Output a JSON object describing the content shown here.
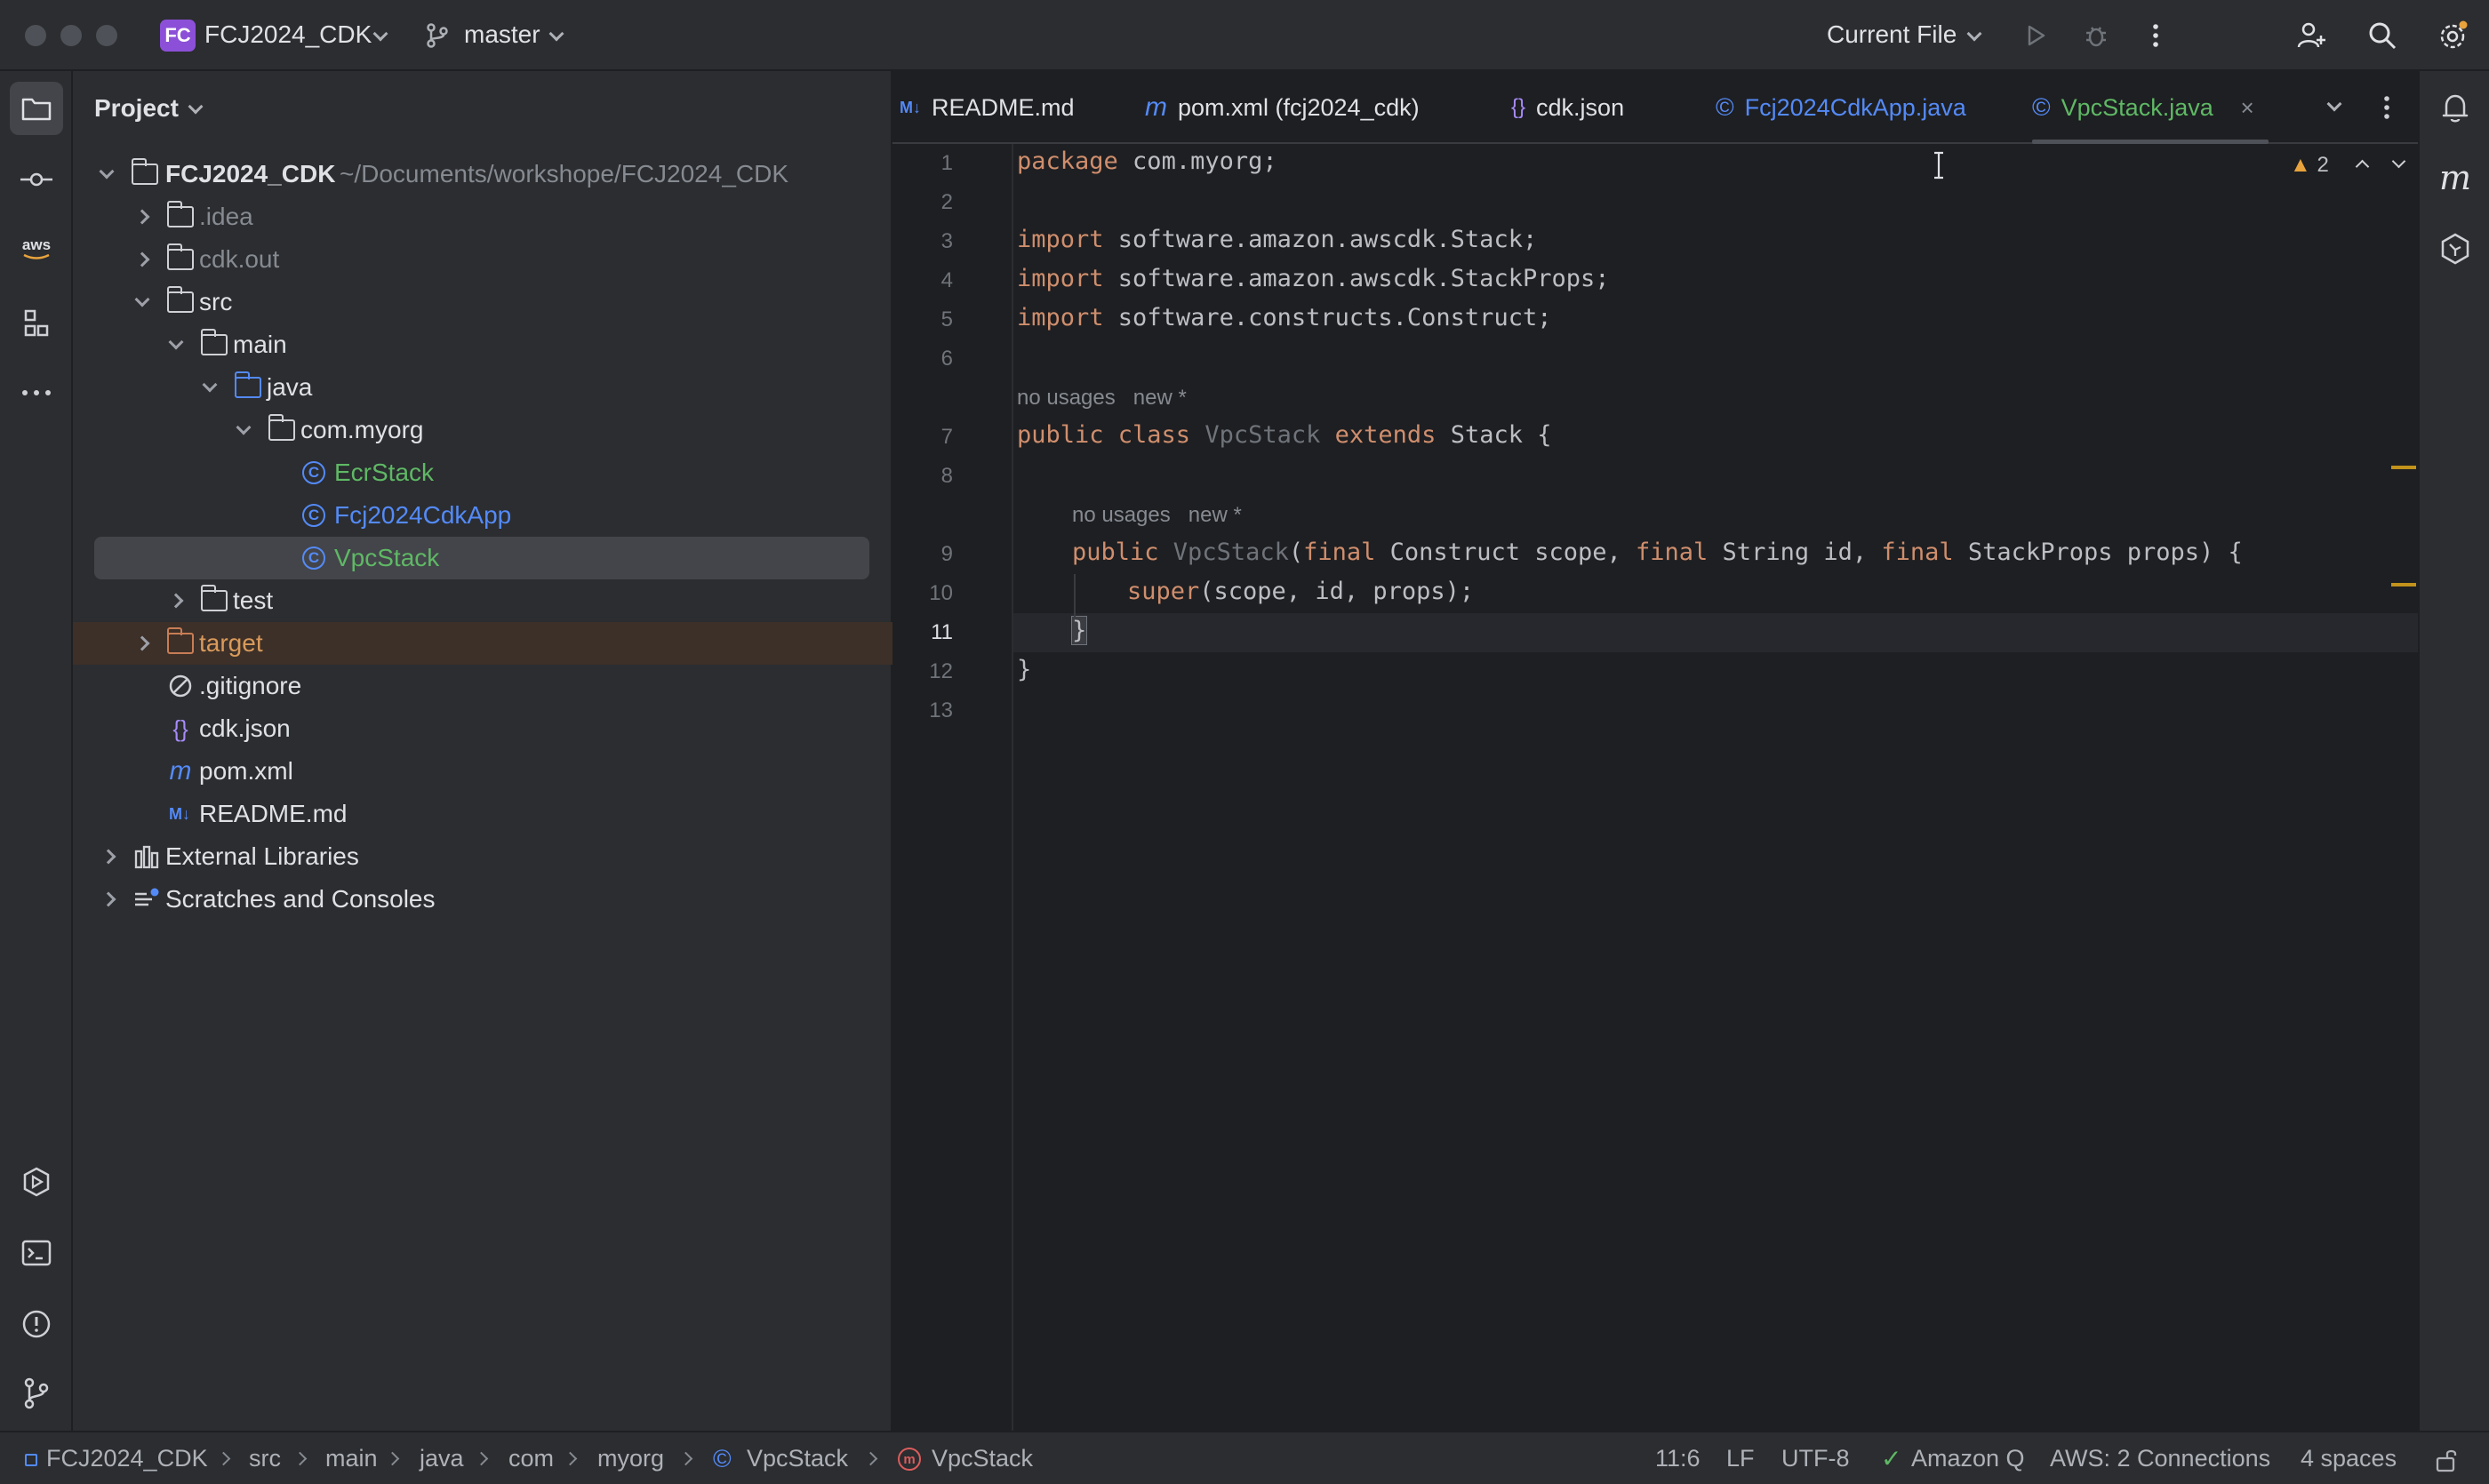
{
  "titlebar": {
    "project_badge": "FC",
    "project_name": "FCJ2024_CDK",
    "branch": "master",
    "run_config": "Current File"
  },
  "project_panel": {
    "title": "Project",
    "tree": [
      {
        "label": "FCJ2024_CDK",
        "path": "~/Documents/workshope/FCJ2024_CDK",
        "type": "root"
      },
      {
        "label": ".idea",
        "type": "folder"
      },
      {
        "label": "cdk.out",
        "type": "folder"
      },
      {
        "label": "src",
        "type": "folder"
      },
      {
        "label": "main",
        "type": "folder"
      },
      {
        "label": "java",
        "type": "source-folder"
      },
      {
        "label": "com.myorg",
        "type": "package"
      },
      {
        "label": "EcrStack",
        "type": "class"
      },
      {
        "label": "Fcj2024CdkApp",
        "type": "class"
      },
      {
        "label": "VpcStack",
        "type": "class"
      },
      {
        "label": "test",
        "type": "folder"
      },
      {
        "label": "target",
        "type": "excluded-folder"
      },
      {
        "label": ".gitignore",
        "type": "file"
      },
      {
        "label": "cdk.json",
        "type": "json"
      },
      {
        "label": "pom.xml",
        "type": "maven"
      },
      {
        "label": "README.md",
        "type": "markdown"
      },
      {
        "label": "External Libraries",
        "type": "libraries"
      },
      {
        "label": "Scratches and Consoles",
        "type": "scratches"
      }
    ]
  },
  "tabs": [
    {
      "label": "README.md",
      "icon": "M↓"
    },
    {
      "label": "pom.xml (fcj2024_cdk)",
      "icon": "m"
    },
    {
      "label": "cdk.json",
      "icon": "{}"
    },
    {
      "label": "Fcj2024CdkApp.java",
      "icon": "©"
    },
    {
      "label": "VpcStack.java",
      "icon": "©"
    }
  ],
  "editor": {
    "warning_count": "2",
    "line_numbers": [
      "1",
      "2",
      "3",
      "4",
      "5",
      "6",
      "7",
      "8",
      "9",
      "10",
      "11",
      "12",
      "13"
    ],
    "hints": {
      "class_usages": "no usages",
      "class_new": "new *",
      "ctor_usages": "no usages",
      "ctor_new": "new *"
    },
    "code": {
      "l1_kw": "package",
      "l1_rest": " com.myorg;",
      "l3_kw": "import",
      "l3_rest": " software.amazon.awscdk.Stack;",
      "l4_kw": "import",
      "l4_rest": " software.amazon.awscdk.StackProps;",
      "l5_kw": "import",
      "l5_rest": " software.constructs.Construct;",
      "l7_kw1": "public class",
      "l7_name": " VpcStack",
      "l7_kw2": " extends",
      "l7_rest": " Stack {",
      "l9_kw": "public",
      "l9_name": " VpcStack",
      "l9_p1": "(",
      "l9_f1": "final",
      "l9_t1": " Construct scope, ",
      "l9_f2": "final",
      "l9_t2": " String id, ",
      "l9_f3": "final",
      "l9_t3": " StackProps props) {",
      "l10_kw": "super",
      "l10_rest": "(scope, id, props);",
      "l11": "}",
      "l12": "}"
    }
  },
  "statusbar": {
    "breadcrumbs": [
      "FCJ2024_CDK",
      "src",
      "main",
      "java",
      "com",
      "myorg",
      "VpcStack",
      "VpcStack"
    ],
    "position": "11:6",
    "line_sep": "LF",
    "encoding": "UTF-8",
    "amazon_q": "Amazon Q",
    "aws": "AWS: 2 Connections",
    "indent": "4 spaces"
  }
}
